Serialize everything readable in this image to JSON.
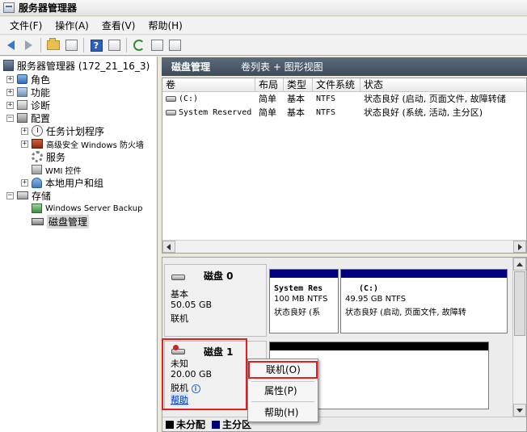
{
  "window": {
    "title": "服务器管理器"
  },
  "menu": [
    "文件(F)",
    "操作(A)",
    "查看(V)",
    "帮助(H)"
  ],
  "tree": {
    "root": "服务器管理器 (172_21_16_3)",
    "roles": "角色",
    "features": "功能",
    "diagnostics": "诊断",
    "configuration": "配置",
    "task_scheduler": "任务计划程序",
    "firewall": "高级安全 Windows 防火墙",
    "services": "服务",
    "wmi": "WMI 控件",
    "local_users": "本地用户和组",
    "storage": "存储",
    "backup": "Windows Server Backup",
    "disk_mgmt": "磁盘管理"
  },
  "right_header": {
    "title": "磁盘管理",
    "view": "卷列表 + 图形视图"
  },
  "volume_table": {
    "columns": [
      "卷",
      "布局",
      "类型",
      "文件系统",
      "状态"
    ],
    "rows": [
      {
        "volume": "(C:)",
        "layout": "简单",
        "type": "基本",
        "fs": "NTFS",
        "status": "状态良好 (启动, 页面文件, 故障转储"
      },
      {
        "volume": "System Reserved",
        "layout": "简单",
        "type": "基本",
        "fs": "NTFS",
        "status": "状态良好 (系统, 活动, 主分区)"
      }
    ]
  },
  "disks": [
    {
      "name": "磁盘 0",
      "kind": "基本",
      "size": "50.05 GB",
      "state": "联机",
      "partitions": [
        {
          "name": "System Res",
          "size_fs": "100 MB NTFS",
          "status": "状态良好 (系"
        },
        {
          "name": "(C:)",
          "size_fs": "49.95 GB NTFS",
          "status": "状态良好 (启动, 页面文件, 故障转"
        }
      ]
    },
    {
      "name": "磁盘 1",
      "kind": "未知",
      "size": "20.00 GB",
      "state": "脱机",
      "help": "帮助"
    }
  ],
  "legend": {
    "unallocated": "未分配",
    "primary": "主分区"
  },
  "context_menu": {
    "online": "联机(O)",
    "properties": "属性(P)",
    "help": "帮助(H)"
  },
  "colors": {
    "partition_bar": "#00007e",
    "unallocated": "#000000",
    "highlight_red": "#e02020"
  }
}
